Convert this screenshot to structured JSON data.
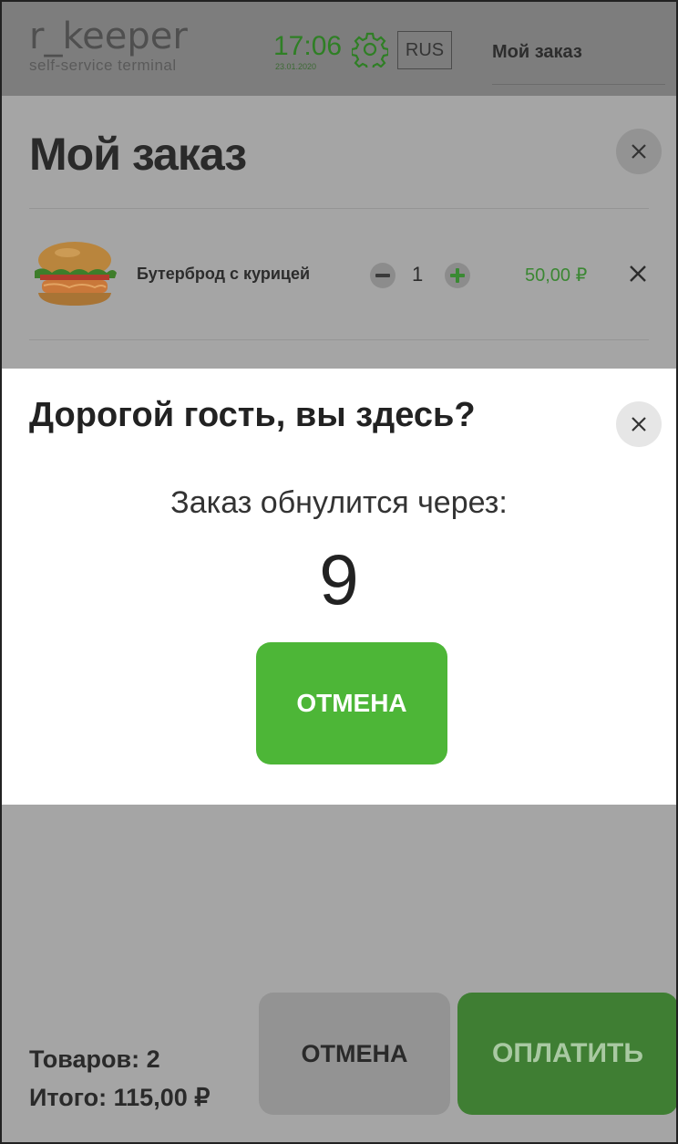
{
  "header": {
    "logo_title": "r_keeper",
    "logo_subtitle": "self-service terminal",
    "time": "17:06",
    "date": "23.01.2020",
    "language": "RUS",
    "order_link": "Мой заказ"
  },
  "order": {
    "title": "Мой заказ",
    "items": [
      {
        "name": "Бутерброд с курицей",
        "quantity": "1",
        "price": "50,00 ₽",
        "icon": "chicken-burger-image"
      }
    ]
  },
  "modal": {
    "title": "Дорогой гость, вы здесь?",
    "message": "Заказ обнулится через:",
    "countdown": "9",
    "cancel_label": "ОТМЕНА"
  },
  "footer": {
    "items_count": "Товаров: 2",
    "total": "Итого: 115,00 ₽",
    "cancel_label": "ОТМЕНА",
    "pay_label": "ОПЛАТИТЬ"
  },
  "colors": {
    "accent_green": "#4db637",
    "pay_green_dim": "#3f7e33",
    "overlay_gray": "#a5a5a5"
  }
}
